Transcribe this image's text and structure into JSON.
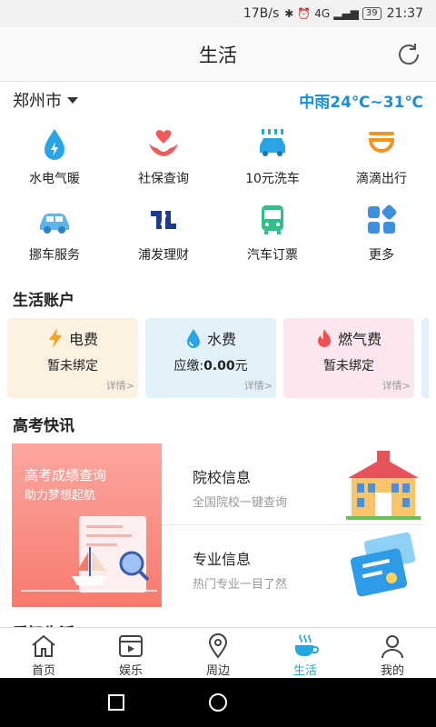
{
  "status_bar": {
    "speed": "17B/s",
    "signal": "4G",
    "battery": "39",
    "time": "21:37"
  },
  "app_bar": {
    "title": "生活"
  },
  "location": {
    "city": "郑州市",
    "weather": "中雨24℃~31℃"
  },
  "services": [
    {
      "label": "水电气暖",
      "icon": "water-drop-icon"
    },
    {
      "label": "社保查询",
      "icon": "heart-hands-icon"
    },
    {
      "label": "10元洗车",
      "icon": "car-wash-icon"
    },
    {
      "label": "滴滴出行",
      "icon": "didi-icon"
    },
    {
      "label": "挪车服务",
      "icon": "car-icon"
    },
    {
      "label": "浦发理财",
      "icon": "spdb-icon"
    },
    {
      "label": "汽车订票",
      "icon": "bus-icon"
    },
    {
      "label": "更多",
      "icon": "grid-more-icon"
    }
  ],
  "life_account": {
    "title": "生活账户",
    "cards": [
      {
        "name": "电费",
        "value": "暂未绑定",
        "more": "详情>",
        "icon": "lightning-icon",
        "bg": "#fdf1e2"
      },
      {
        "name": "水费",
        "value_prefix": "应缴:",
        "value_amount": "0.00",
        "value_suffix": "元",
        "more": "详情>",
        "icon": "water-drop-icon",
        "bg": "#e3f2fa"
      },
      {
        "name": "燃气费",
        "value": "暂未绑定",
        "more": "详情>",
        "icon": "flame-icon",
        "bg": "#fce8ec"
      }
    ]
  },
  "gaokao": {
    "title": "高考快讯",
    "banner_line1": "高考成绩查询",
    "banner_line2": "助力梦想起航",
    "items": [
      {
        "title": "院校信息",
        "subtitle": "全国院校一键查询",
        "icon": "school-building-icon"
      },
      {
        "title": "专业信息",
        "subtitle": "热门专业一目了然",
        "icon": "phone-card-icon"
      }
    ]
  },
  "partial_section": "爱智生活",
  "tabs": [
    {
      "label": "首页",
      "icon": "home-icon"
    },
    {
      "label": "娱乐",
      "icon": "video-icon"
    },
    {
      "label": "周边",
      "icon": "location-pin-icon"
    },
    {
      "label": "生活",
      "icon": "coffee-cup-icon",
      "active": true
    },
    {
      "label": "我的",
      "icon": "person-icon"
    }
  ],
  "colors": {
    "accent": "#22a7e0",
    "weather": "#1a8fd8"
  }
}
